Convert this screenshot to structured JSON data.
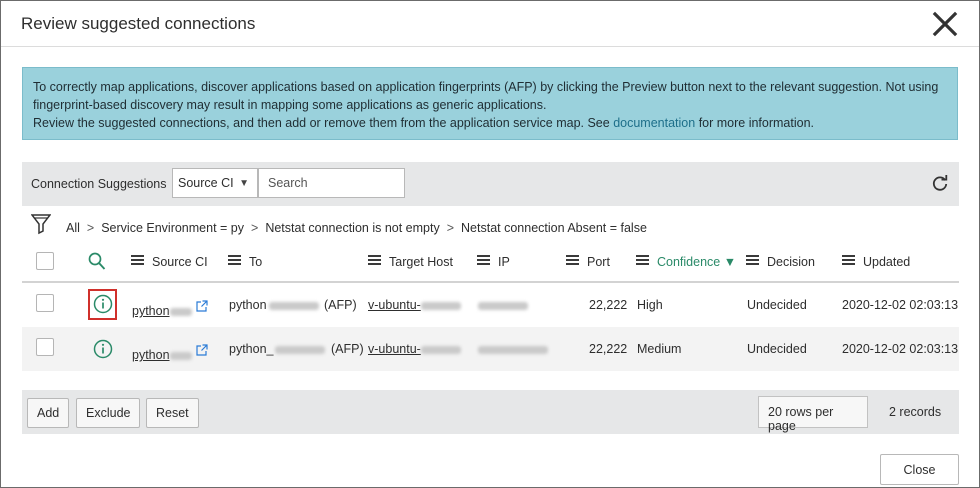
{
  "dialog": {
    "title": "Review suggested connections"
  },
  "info": {
    "line1": "To correctly map applications, discover applications based on application fingerprints (AFP) by clicking the Preview button next to the relevant suggestion. Not using fingerprint-based discovery may result in mapping some applications as generic applications.",
    "line2_pre": "Review the suggested connections, and then add or remove them from the application service map. See ",
    "link": "documentation",
    "line2_post": " for more information."
  },
  "toolbar": {
    "label": "Connection Suggestions",
    "select_value": "Source CI",
    "search_placeholder": "Search"
  },
  "breadcrumb": {
    "parts": [
      "All",
      "Service Environment = py",
      "Netstat connection is not empty",
      "Netstat connection Absent = false"
    ],
    "separator": ">"
  },
  "columns": {
    "source_ci": "Source CI",
    "to": "To",
    "target_host": "Target Host",
    "ip": "IP",
    "port": "Port",
    "confidence": "Confidence",
    "decision": "Decision",
    "updated": "Updated"
  },
  "rows": [
    {
      "source": "python",
      "to_pre": "python",
      "to_post": "(AFP)",
      "host": "v-ubuntu-",
      "port": "22,222",
      "confidence": "High",
      "decision": "Undecided",
      "updated": "2020-12-02 02:03:13"
    },
    {
      "source": "python",
      "to_pre": "python_",
      "to_post": "(AFP)",
      "host": "v-ubuntu-",
      "port": "22,222",
      "confidence": "Medium",
      "decision": "Undecided",
      "updated": "2020-12-02 02:03:13"
    }
  ],
  "footer": {
    "add": "Add",
    "exclude": "Exclude",
    "reset": "Reset",
    "rows_per_page": "20 rows per page",
    "records": "2 records"
  },
  "close_label": "Close",
  "colors": {
    "accent": "#2a8a68",
    "banner": "#9ad1dc",
    "highlight": "#d0302b"
  },
  "icons": [
    "close-icon",
    "chevron-down-icon",
    "refresh-icon",
    "filter-icon",
    "search-icon",
    "column-menu-icon",
    "info-icon",
    "external-link-icon"
  ]
}
